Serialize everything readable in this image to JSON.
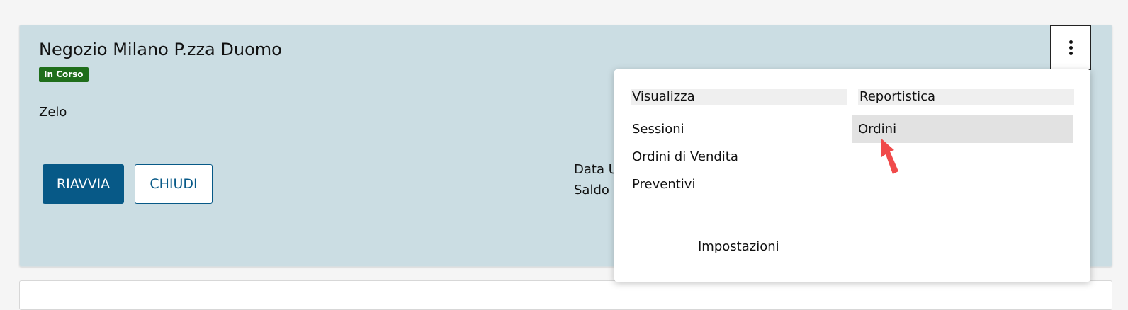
{
  "store": {
    "title": "Negozio Milano P.zza Duomo",
    "status": "In Corso",
    "subtitle": "Zelo"
  },
  "actions": {
    "restart_label": "RIAVVIA",
    "close_label": "CHIUDI"
  },
  "info": {
    "line1": "Data U",
    "line2": "Saldo"
  },
  "menu": {
    "trigger_icon": "kebab-vertical-icon",
    "columns": [
      {
        "header": "Visualizza",
        "items": [
          "Sessioni",
          "Ordini di Vendita",
          "Preventivi"
        ]
      },
      {
        "header": "Reportistica",
        "items": [
          "Ordini"
        ]
      }
    ],
    "active_item": "Ordini",
    "footer_item": "Impostazioni"
  },
  "colors": {
    "card_bg": "#cbdde3",
    "primary": "#075987",
    "status_green": "#1f6e1b",
    "cursor_red": "#f04a4a"
  }
}
